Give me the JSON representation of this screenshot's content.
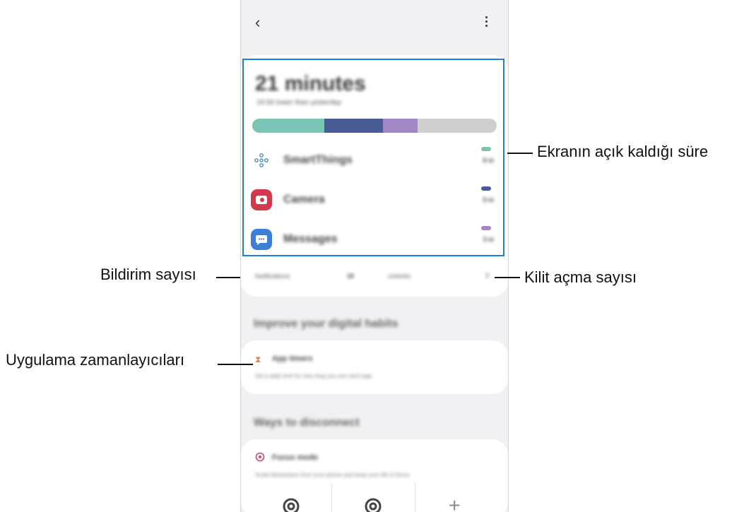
{
  "annotations": {
    "screen_time": "Ekranın açık kaldığı süre",
    "notifications": "Bildirim sayısı",
    "unlocks": "Kilit açma sayısı",
    "app_timers": "Uygulama zamanlayıcıları"
  },
  "usage": {
    "minutes": "21 minutes",
    "subtitle": "16:56 lower than yesterday",
    "bar_segments": [
      {
        "fraction": 0.295,
        "color": "#79c6b5"
      },
      {
        "fraction": 0.24,
        "color": "#4a5c95"
      },
      {
        "fraction": 0.14,
        "color": "#a187c7"
      }
    ],
    "apps": [
      {
        "name": "SmartThings",
        "time": "8 m",
        "color": "#79c6b5",
        "icon": "smartthings-icon"
      },
      {
        "name": "Camera",
        "time": "5 m",
        "color": "#4a5c95",
        "icon": "camera-icon"
      },
      {
        "name": "Messages",
        "time": "3 m",
        "color": "#a187c7",
        "icon": "messages-icon"
      }
    ],
    "notifications_label": "Notifications",
    "notifications_count": "28",
    "unlocks_label": "Unlocks",
    "unlocks_count": "7"
  },
  "sections": {
    "improve_title": "Improve your digital habits",
    "app_timers_title": "App timers",
    "app_timers_desc": "Set a daily limit for how long you use each app.",
    "disconnect_title": "Ways to disconnect",
    "focus_title": "Focus mode",
    "focus_desc": "Avoid distractions from your phone and keep your life in focus."
  },
  "colors": {
    "highlight": "#1f7ed8",
    "camera": "#d2394d",
    "messages": "#3d7fd8",
    "timer": "#e47c4a",
    "focus": "#d04a6b"
  }
}
